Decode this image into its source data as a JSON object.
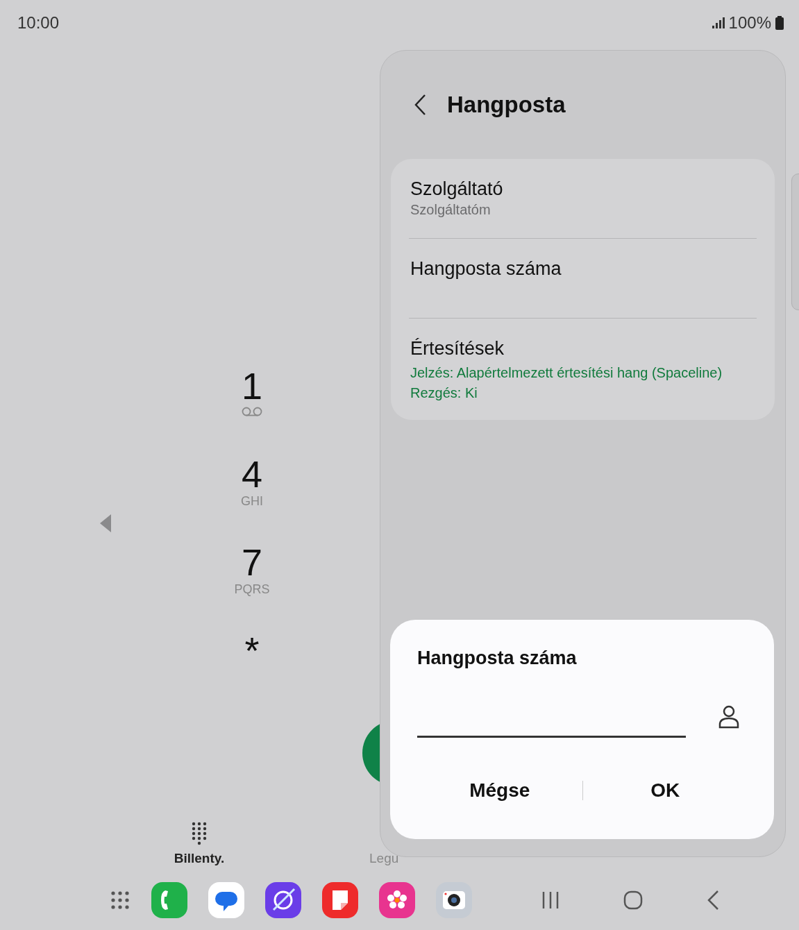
{
  "status_bar": {
    "time": "10:00",
    "battery": "100%"
  },
  "dialpad": {
    "keys": [
      {
        "digit": "1",
        "kind": "voicemail"
      },
      {
        "digit": "4",
        "kind": "letters",
        "letters": "GHI"
      },
      {
        "digit": "7",
        "kind": "letters",
        "letters": "PQRS"
      },
      {
        "digit": "*",
        "kind": "plain"
      }
    ]
  },
  "tabs": [
    {
      "label": "Billenty.",
      "selected": true
    },
    {
      "label": "Legu",
      "selected": false
    }
  ],
  "panel": {
    "title": "Hangposta",
    "items": [
      {
        "title": "Szolgáltató",
        "summary": "Szolgáltatóm"
      },
      {
        "title": "Hangposta száma"
      },
      {
        "title": "Értesítések",
        "details": [
          "Jelzés: Alapértelmezett értesítési hang (Spaceline)",
          "Rezgés: Ki"
        ]
      }
    ]
  },
  "dialog": {
    "title": "Hangposta száma",
    "buttons": [
      "Mégse",
      "OK"
    ]
  }
}
